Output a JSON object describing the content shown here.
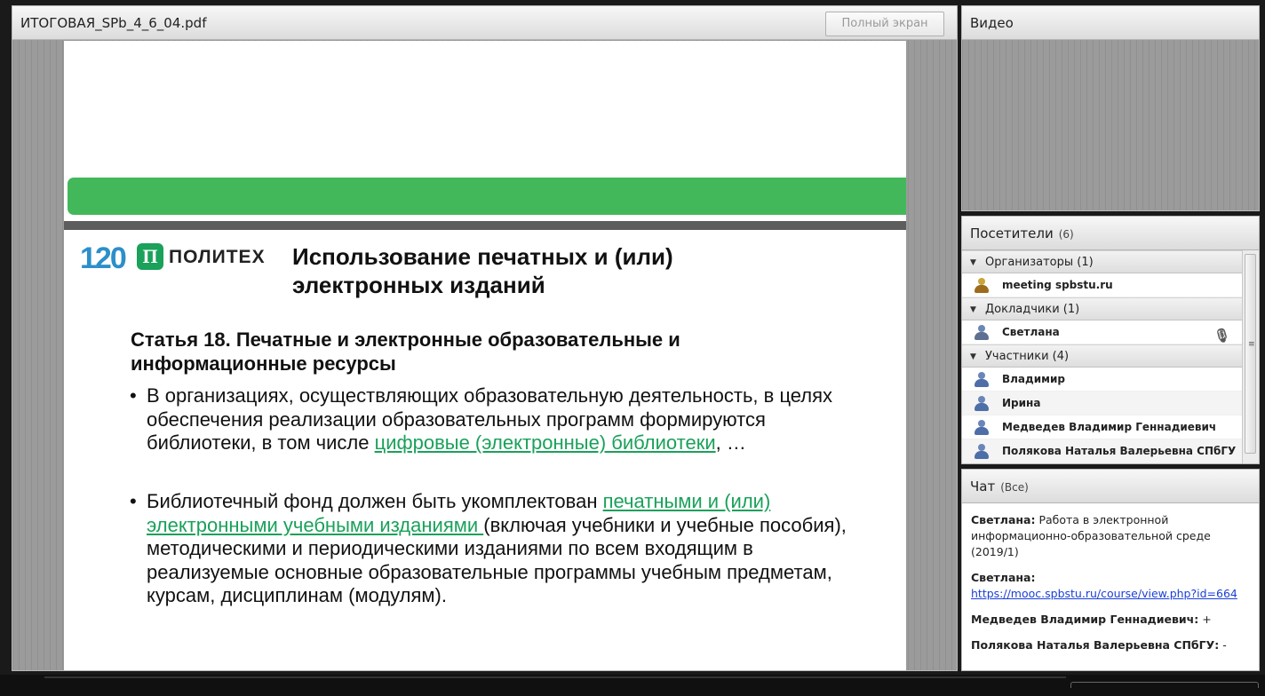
{
  "share_pod": {
    "title": "ИТОГОВАЯ_SPb_4_6_04.pdf",
    "fullscreen_label": "Полный экран"
  },
  "slide": {
    "logo_number": "120",
    "logo_mark": "П",
    "logo_text": "ПОЛИТЕХ",
    "title": "Использование печатных и (или) электронных изданий",
    "subtitle": "Статья 18. Печатные и электронные образовательные и информационные ресурсы",
    "bullet_char": "•",
    "bullet1": {
      "text_before": "В организациях, осуществляющих образовательную деятельность, в целях обеспечения реализации образовательных программ формируются библиотеки, в том числе ",
      "link": "цифровые (электронные) библиотеки",
      "text_after": ", …"
    },
    "bullet2": {
      "text_before": "Библиотечный фонд должен быть укомплектован ",
      "link": "печатными и (или) электронными учебными изданиями ",
      "text_after": "(включая учебники и учебные пособия), методическими и периодическими изданиями по всем входящим в реализуемые основные образовательные программы учебным предметам, курсам, дисциплинам (модулям)."
    },
    "colors": {
      "green": "#42b85a",
      "link": "#1aa15a",
      "logo_blue": "#2c8fc9"
    }
  },
  "video_pod": {
    "title": "Видео"
  },
  "attendees_pod": {
    "title": "Посетители",
    "count": "(6)",
    "groups": {
      "hosts": {
        "label": "Организаторы (1)",
        "members": [
          "meeting spbstu.ru"
        ]
      },
      "presenters": {
        "label": "Докладчики (1)",
        "members": [
          "Светлана"
        ]
      },
      "participants": {
        "label": "Участники (4)",
        "members": [
          "Владимир",
          "Ирина",
          "Медведев Владимир Геннадиевич",
          "Полякова Наталья Валерьевна СПбГУ"
        ]
      }
    }
  },
  "chat_pod": {
    "title": "Чат",
    "filter": "(Все)",
    "messages": [
      {
        "sender": "Светлана:",
        "text": "Работа в электронной информационно-образовательной среде (2019/1)"
      },
      {
        "sender": "Светлана:",
        "link": "https://mooc.spbstu.ru/course/view.php?id=664"
      },
      {
        "sender": "Медведев Владимир Геннадиевич:",
        "text": "+"
      },
      {
        "sender": "Полякова Наталья Валерьевна СПбГУ:",
        "text": "-"
      }
    ]
  },
  "icons": {
    "collapse": "triangle-down-icon",
    "attendee": "user-icon",
    "host": "host-user-icon",
    "presenter": "presenter-user-icon",
    "microphone": "microphone-icon"
  }
}
